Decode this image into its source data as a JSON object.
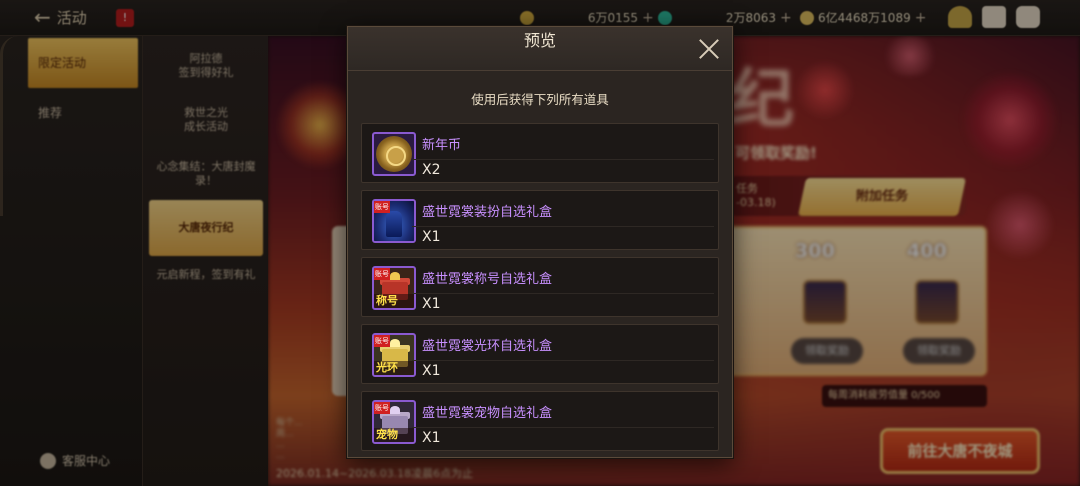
{
  "topbar": {
    "back_label": "活动",
    "badge": "!",
    "currencies": [
      {
        "icon": "gold-coin-icon",
        "value": "6万0155",
        "color": "#d8b040"
      },
      {
        "icon": "gem-icon",
        "value": "2万8063",
        "color": "#30c0a0"
      },
      {
        "icon": "silver-coin-icon",
        "value": "6亿4468万1089",
        "color": "#e0c060"
      }
    ],
    "icons": [
      "treasure-icon",
      "mail-icon",
      "chat-icon"
    ]
  },
  "sidebar_main": {
    "items": [
      {
        "label": "限定活动",
        "active": true
      },
      {
        "label": "推荐",
        "active": false
      }
    ],
    "service_label": "客服中心"
  },
  "sidebar_sub": {
    "items": [
      {
        "label": "阿拉德\n签到得好礼"
      },
      {
        "label": "救世之光\n成长活动"
      },
      {
        "label": "心念集结：大唐封魔录！"
      },
      {
        "label": "大唐夜行纪",
        "active": true
      },
      {
        "label": "元启新程，签到有礼"
      }
    ]
  },
  "background": {
    "title_glyph": "纪",
    "subtitle": "可领取奖励!",
    "task_tab_left": "任务\n-03.18)",
    "task_tab_active": "附加任务",
    "rewards": [
      {
        "amount": "300",
        "button": "领取奖励"
      },
      {
        "amount": "400",
        "button": "领取奖励"
      }
    ],
    "weekly_limit": "每周消耗疲劳值量 0/500",
    "goto_button": "前往大唐不夜城",
    "date_range": "2026.01.14~2026.03.18凌晨6点为止"
  },
  "modal": {
    "title": "预览",
    "description": "使用后获得下列所有道具",
    "items": [
      {
        "name": "新年币",
        "quantity": "X2",
        "icon": "new-year-coin-icon"
      },
      {
        "name": "盛世霓裳装扮自选礼盒",
        "quantity": "X1",
        "icon": "costume-box-icon",
        "tag_top": "账号"
      },
      {
        "name": "盛世霓裳称号自选礼盒",
        "quantity": "X1",
        "icon": "title-box-icon",
        "tag_top": "账号",
        "tag_bottom": "称号"
      },
      {
        "name": "盛世霓裳光环自选礼盒",
        "quantity": "X1",
        "icon": "aura-box-icon",
        "tag_top": "账号",
        "tag_bottom": "光环"
      },
      {
        "name": "盛世霓裳宠物自选礼盒",
        "quantity": "X1",
        "icon": "pet-box-icon",
        "tag_top": "账号",
        "tag_bottom": "宠物"
      }
    ]
  }
}
